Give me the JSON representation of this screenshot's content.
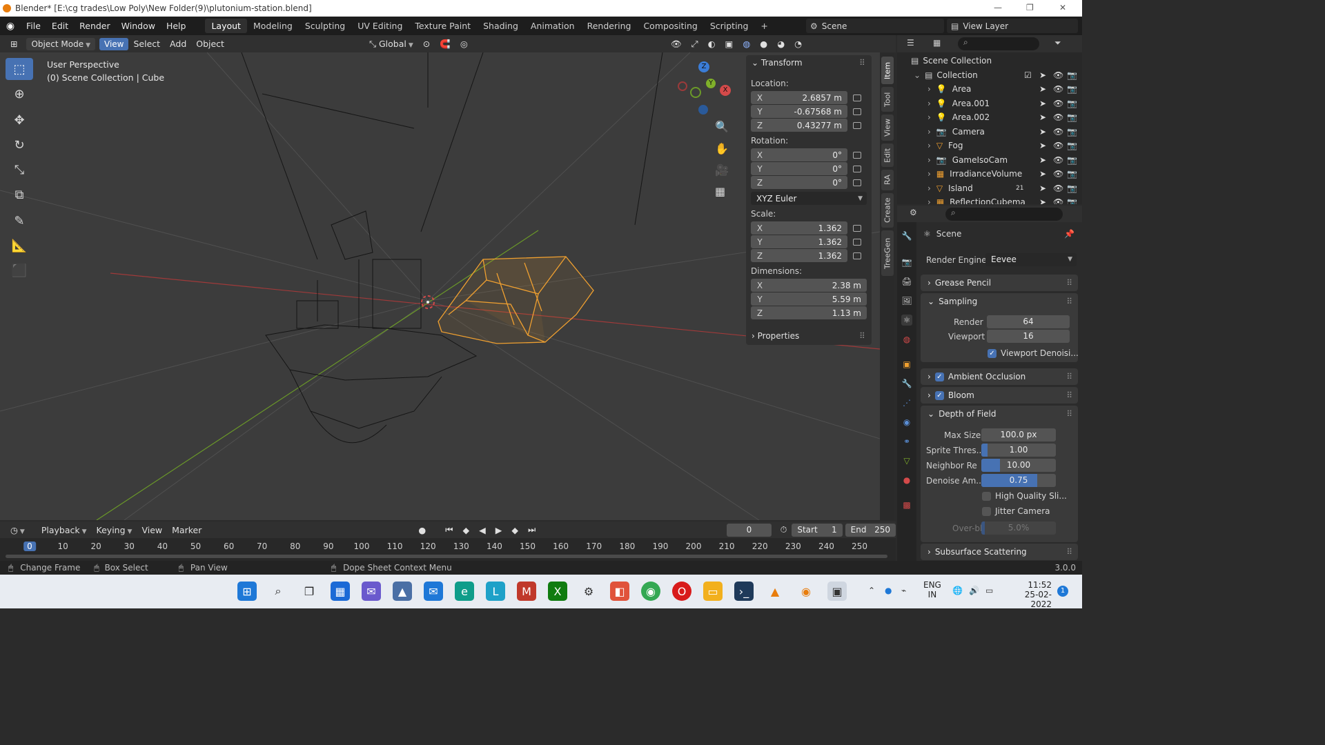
{
  "window": {
    "title": "Blender* [E:\\cg trades\\Low Poly\\New Folder(9)\\plutonium-station.blend]"
  },
  "menubar": {
    "menus": [
      "File",
      "Edit",
      "Render",
      "Window",
      "Help"
    ],
    "workspaces": [
      "Layout",
      "Modeling",
      "Sculpting",
      "UV Editing",
      "Texture Paint",
      "Shading",
      "Animation",
      "Rendering",
      "Compositing",
      "Scripting"
    ],
    "add_workspace": "+",
    "scene_name": "Scene",
    "view_layer": "View Layer"
  },
  "viewport_header": {
    "mode": "Object Mode",
    "view": "View",
    "select": "Select",
    "add": "Add",
    "object": "Object",
    "orientation": "Global"
  },
  "viewport": {
    "perspective": "User Perspective",
    "context": "(0) Scene Collection | Cube",
    "gizmo": {
      "x": "X",
      "y": "Y",
      "z": "Z"
    }
  },
  "npanel": {
    "transform_title": "Transform",
    "location_label": "Location:",
    "location": {
      "x": "2.6857 m",
      "y": "-0.67568 m",
      "z": "0.43277 m"
    },
    "rotation_label": "Rotation:",
    "rotation": {
      "x": "0°",
      "y": "0°",
      "z": "0°"
    },
    "rotation_mode": "XYZ Euler",
    "scale_label": "Scale:",
    "scale": {
      "x": "1.362",
      "y": "1.362",
      "z": "1.362"
    },
    "dimensions_label": "Dimensions:",
    "dimensions": {
      "x": "2.38 m",
      "y": "5.59 m",
      "z": "1.13 m"
    },
    "properties_title": "Properties",
    "axis": {
      "x": "X",
      "y": "Y",
      "z": "Z"
    },
    "tabs": [
      "Item",
      "Tool",
      "View",
      "Edit",
      "RA",
      "Create",
      "TreeGen"
    ]
  },
  "outliner": {
    "scene_collection": "Scene Collection",
    "collection": "Collection",
    "items": [
      {
        "name": "Area"
      },
      {
        "name": "Area.001"
      },
      {
        "name": "Area.002"
      },
      {
        "name": "Camera"
      },
      {
        "name": "Fog"
      },
      {
        "name": "GameIsoCam"
      },
      {
        "name": "IrradianceVolume"
      },
      {
        "name": "Island"
      },
      {
        "name": "ReflectionCubema"
      }
    ],
    "island_badge": "21"
  },
  "properties": {
    "context_title": "Scene",
    "render_engine_label": "Render Engine",
    "render_engine": "Eevee",
    "grease_pencil": "Grease Pencil",
    "sampling": "Sampling",
    "render_label": "Render",
    "render_samples": "64",
    "viewport_label": "Viewport",
    "viewport_samples": "16",
    "viewport_denoise": "Viewport Denoisi...",
    "ambient_occlusion": "Ambient Occlusion",
    "bloom": "Bloom",
    "depth_of_field": "Depth of Field",
    "max_size_label": "Max Size",
    "max_size": "100.0 px",
    "sprite_label": "Sprite Thres...",
    "sprite": "1.00",
    "sprite_fill": 0.08,
    "neighbor_label": "Neighbor Re",
    "neighbor": "10.00",
    "neighbor_fill": 0.25,
    "denoise_label": "Denoise Am...",
    "denoise": "0.75",
    "denoise_fill": 0.75,
    "high_quality": "High Quality Sli...",
    "jitter_camera": "Jitter Camera",
    "overblur_label": "Over-blur",
    "overblur": "5.0%",
    "overblur_fill": 0.05,
    "subsurface": "Subsurface Scattering"
  },
  "timeline": {
    "playback": "Playback",
    "keying": "Keying",
    "view": "View",
    "marker": "Marker",
    "current_frame": "0",
    "start_label": "Start",
    "start": "1",
    "end_label": "End",
    "end": "250",
    "ticks": [
      "0",
      "10",
      "20",
      "30",
      "40",
      "50",
      "60",
      "70",
      "80",
      "90",
      "100",
      "110",
      "120",
      "130",
      "140",
      "150",
      "160",
      "170",
      "180",
      "190",
      "200",
      "210",
      "220",
      "230",
      "240",
      "250"
    ]
  },
  "statusbar": {
    "change_frame": "Change Frame",
    "box_select": "Box Select",
    "pan_view": "Pan View",
    "context_menu": "Dope Sheet Context Menu",
    "version": "3.0.0"
  },
  "taskbar": {
    "lang": "ENG",
    "region": "IN",
    "time": "11:52",
    "date": "25-02-2022",
    "notif": "1",
    "app_letter": "L"
  },
  "colors": {
    "accent": "#4772b3",
    "selection": "#f0a030",
    "x_axis": "#d44a4a",
    "y_axis": "#7fb02a",
    "z_axis": "#3b7dd8"
  }
}
